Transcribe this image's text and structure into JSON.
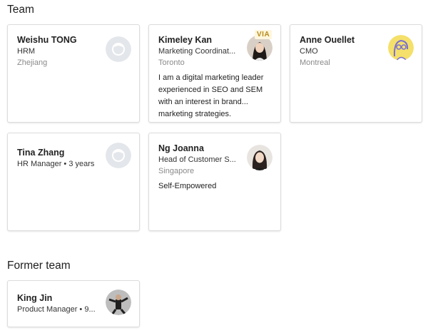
{
  "sections": {
    "team_title": "Team",
    "former_title": "Former team"
  },
  "team": [
    {
      "name": "Weishu TONG",
      "role": "HRM",
      "location": "Zhejiang",
      "bio": "",
      "avatar": "placeholder-avatar-icon"
    },
    {
      "name": "Kimeley Kan",
      "role": "Marketing Coordinat...",
      "location": "Toronto",
      "bio": "I am a digital marketing leader experienced in SEO and SEM with an interest in brand... marketing strategies.",
      "avatar": "photo",
      "badge": "VIA"
    },
    {
      "name": "Anne Ouellet",
      "role": "CMO",
      "location": "Montreal",
      "bio": "",
      "avatar": "illustration"
    },
    {
      "name": "Tina Zhang",
      "role": "HR Manager • 3 years",
      "location": "",
      "bio": "",
      "avatar": "placeholder-avatar-icon"
    },
    {
      "name": "Ng Joanna",
      "role": "Head of Customer S...",
      "location": "Singapore",
      "bio": "Self-Empowered",
      "avatar": "photo"
    }
  ],
  "former_team": [
    {
      "name": "King Jin",
      "role": "Product Manager • 9...",
      "location": "",
      "avatar": "photo"
    }
  ],
  "colors": {
    "placeholder_bg": "#e3e6ea",
    "placeholder_ring": "#ffffff",
    "illustration_bg": "#f4e06a",
    "illustration_line": "#7a6fd1",
    "badge_text": "#b58a1a"
  }
}
